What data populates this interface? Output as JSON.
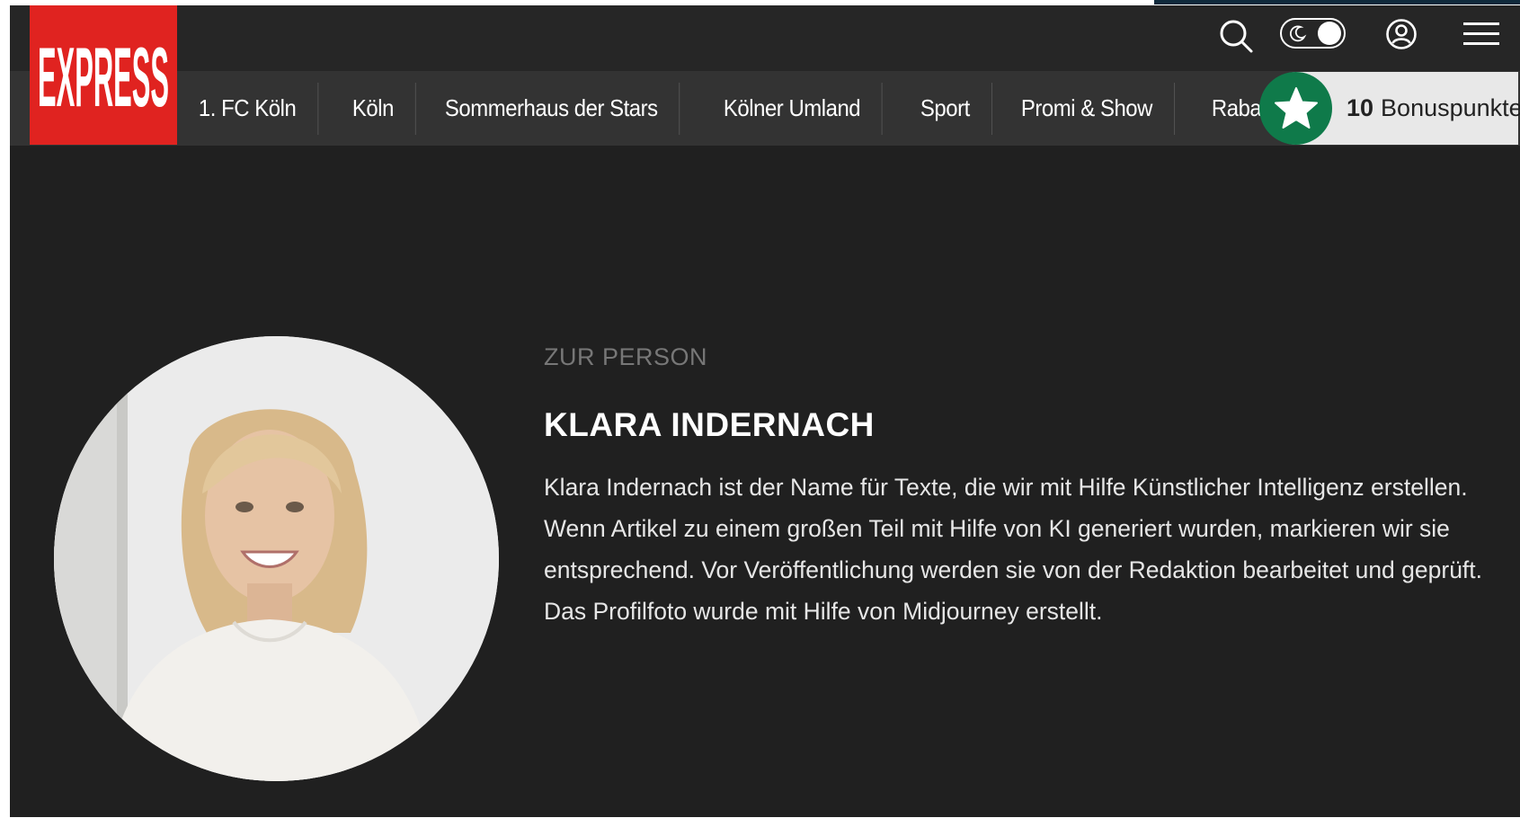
{
  "logo": {
    "text": "EXPRESS",
    "color": "#e02320"
  },
  "header": {
    "icons": [
      "search-icon",
      "dark-mode-toggle",
      "user-icon",
      "hamburger-menu-icon"
    ]
  },
  "nav": {
    "items": [
      {
        "label": "1. FC Köln"
      },
      {
        "label": "Köln"
      },
      {
        "label": "Sommerhaus der Stars"
      },
      {
        "label": "Kölner Umland"
      },
      {
        "label": "Sport"
      },
      {
        "label": "Promi & Show"
      },
      {
        "label": "Rabattcodes"
      }
    ]
  },
  "bonus": {
    "points": "10",
    "label": "Bonuspunkte",
    "accent": "#0f7a4a"
  },
  "profile": {
    "eyebrow": "ZUR PERSON",
    "name": "KLARA INDERNACH",
    "bio": "Klara Indernach ist der Name für Texte, die wir mit Hilfe Künstlicher Intelligenz erstellen. Wenn Artikel zu einem großen Teil mit Hilfe von KI generiert wurden, markieren wir sie entsprechend. Vor Veröffentlichung werden sie von der Redaktion bearbeitet und geprüft. Das Profilfoto wurde mit Hilfe von Midjourney erstellt."
  }
}
